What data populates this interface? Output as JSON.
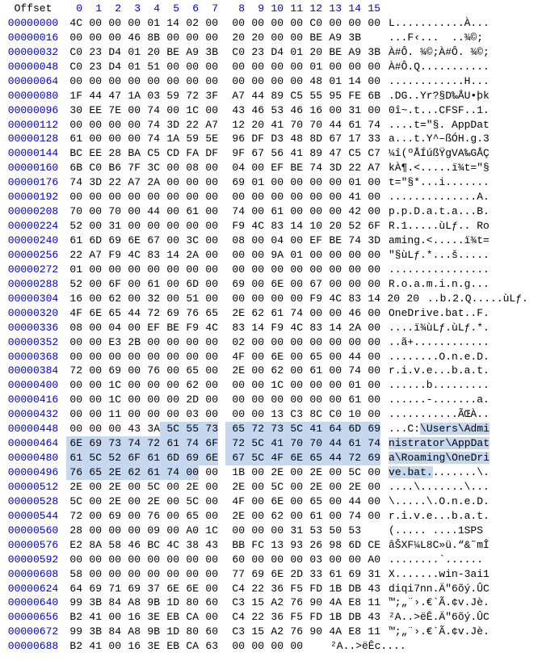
{
  "header": {
    "offset_label": "Offset",
    "cols": [
      "0",
      "1",
      "2",
      "3",
      "4",
      "5",
      "6",
      "7",
      "8",
      "9",
      "10",
      "11",
      "12",
      "13",
      "14",
      "15"
    ]
  },
  "highlight": {
    "start": 453,
    "end": 503
  },
  "rows": [
    {
      "offset": "00000000",
      "hex": [
        "4C",
        "00",
        "00",
        "00",
        "01",
        "14",
        "02",
        "00",
        "00",
        "00",
        "00",
        "00",
        "C0",
        "00",
        "00",
        "00"
      ],
      "ascii": "L...........À..."
    },
    {
      "offset": "00000016",
      "hex": [
        "00",
        "00",
        "00",
        "46",
        "8B",
        "00",
        "00",
        "00",
        "20",
        "20",
        "00",
        "00",
        "BE",
        "A9",
        "3B",
        ""
      ],
      "ascii": "...F‹...  ..¾©;"
    },
    {
      "offset": "00000032",
      "hex": [
        "C0",
        "23",
        "D4",
        "01",
        "20",
        "BE",
        "A9",
        "3B",
        "C0",
        "23",
        "D4",
        "01",
        "20",
        "BE",
        "A9",
        "3B"
      ],
      "ascii": "À#Ô. ¾©;À#Ô. ¾©;"
    },
    {
      "offset": "00000048",
      "hex": [
        "C0",
        "23",
        "D4",
        "01",
        "51",
        "00",
        "00",
        "00",
        "00",
        "00",
        "00",
        "00",
        "01",
        "00",
        "00",
        "00"
      ],
      "ascii": "À#Ô.Q..........."
    },
    {
      "offset": "00000064",
      "hex": [
        "00",
        "00",
        "00",
        "00",
        "00",
        "00",
        "00",
        "00",
        "00",
        "00",
        "00",
        "00",
        "48",
        "01",
        "14",
        "00"
      ],
      "ascii": "............H..."
    },
    {
      "offset": "00000080",
      "hex": [
        "1F",
        "44",
        "47",
        "1A",
        "03",
        "59",
        "72",
        "3F",
        "A7",
        "44",
        "89",
        "C5",
        "55",
        "95",
        "FE",
        "6B"
      ],
      "ascii": ".DG..Yr?§D‰ÅU•þk"
    },
    {
      "offset": "00000096",
      "hex": [
        "30",
        "EE",
        "7E",
        "00",
        "74",
        "00",
        "1C",
        "00",
        "43",
        "46",
        "53",
        "46",
        "16",
        "00",
        "31",
        "00"
      ],
      "ascii": "0î~.t...CFSF..1."
    },
    {
      "offset": "00000112",
      "hex": [
        "00",
        "00",
        "00",
        "00",
        "74",
        "3D",
        "22",
        "A7",
        "12",
        "20",
        "41",
        "70",
        "70",
        "44",
        "61",
        "74"
      ],
      "ascii": "....t=\"§. AppDat"
    },
    {
      "offset": "00000128",
      "hex": [
        "61",
        "00",
        "00",
        "00",
        "74",
        "1A",
        "59",
        "5E",
        "96",
        "DF",
        "D3",
        "48",
        "8D",
        "67",
        "17",
        "33"
      ],
      "ascii": "a...t.Y^–ßÓH.g.3"
    },
    {
      "offset": "00000144",
      "hex": [
        "BC",
        "EE",
        "28",
        "BA",
        "C5",
        "CD",
        "FA",
        "DF",
        "9F",
        "67",
        "56",
        "41",
        "89",
        "47",
        "C5",
        "C7"
      ],
      "ascii": "¼î(ºÅÍúßŸgVA‰GÅÇ"
    },
    {
      "offset": "00000160",
      "hex": [
        "6B",
        "C0",
        "B6",
        "7F",
        "3C",
        "00",
        "08",
        "00",
        "04",
        "00",
        "EF",
        "BE",
        "74",
        "3D",
        "22",
        "A7"
      ],
      "ascii": "kÀ¶.<.....ï¾t=\"§"
    },
    {
      "offset": "00000176",
      "hex": [
        "74",
        "3D",
        "22",
        "A7",
        "2A",
        "00",
        "00",
        "00",
        "69",
        "01",
        "00",
        "00",
        "00",
        "00",
        "01",
        "00"
      ],
      "ascii": "t=\"§*...i......."
    },
    {
      "offset": "00000192",
      "hex": [
        "00",
        "00",
        "00",
        "00",
        "00",
        "00",
        "00",
        "00",
        "00",
        "00",
        "00",
        "00",
        "00",
        "00",
        "41",
        "00"
      ],
      "ascii": "..............A."
    },
    {
      "offset": "00000208",
      "hex": [
        "70",
        "00",
        "70",
        "00",
        "44",
        "00",
        "61",
        "00",
        "74",
        "00",
        "61",
        "00",
        "00",
        "00",
        "42",
        "00"
      ],
      "ascii": "p.p.D.a.t.a...B."
    },
    {
      "offset": "00000224",
      "hex": [
        "52",
        "00",
        "31",
        "00",
        "00",
        "00",
        "00",
        "00",
        "F9",
        "4C",
        "83",
        "14",
        "10",
        "20",
        "52",
        "6F"
      ],
      "ascii": "R.1.....ùLƒ.. Ro"
    },
    {
      "offset": "00000240",
      "hex": [
        "61",
        "6D",
        "69",
        "6E",
        "67",
        "00",
        "3C",
        "00",
        "08",
        "00",
        "04",
        "00",
        "EF",
        "BE",
        "74",
        "3D"
      ],
      "ascii": "aming.<.....ï¾t="
    },
    {
      "offset": "00000256",
      "hex": [
        "22",
        "A7",
        "F9",
        "4C",
        "83",
        "14",
        "2A",
        "00",
        "00",
        "00",
        "9A",
        "01",
        "00",
        "00",
        "00",
        "00"
      ],
      "ascii": "\"§ùLƒ.*...š....."
    },
    {
      "offset": "00000272",
      "hex": [
        "01",
        "00",
        "00",
        "00",
        "00",
        "00",
        "00",
        "00",
        "00",
        "00",
        "00",
        "00",
        "00",
        "00",
        "00",
        "00"
      ],
      "ascii": "................"
    },
    {
      "offset": "00000288",
      "hex": [
        "52",
        "00",
        "6F",
        "00",
        "61",
        "00",
        "6D",
        "00",
        "69",
        "00",
        "6E",
        "00",
        "67",
        "00",
        "00",
        "00"
      ],
      "ascii": "R.o.a.m.i.n.g..."
    },
    {
      "offset": "00000304",
      "hex": [
        "16",
        "00",
        "62",
        "00",
        "32",
        "00",
        "51",
        "00",
        "00",
        "00",
        "00",
        "00",
        "F9",
        "4C",
        "83",
        "14",
        "20",
        "20"
      ],
      "ascii": "..b.2.Q.....ùLƒ.  "
    },
    {
      "offset": "00000320",
      "hex": [
        "4F",
        "6E",
        "65",
        "44",
        "72",
        "69",
        "76",
        "65",
        "2E",
        "62",
        "61",
        "74",
        "00",
        "00",
        "46",
        "00"
      ],
      "ascii": "OneDrive.bat..F."
    },
    {
      "offset": "00000336",
      "hex": [
        "08",
        "00",
        "04",
        "00",
        "EF",
        "BE",
        "F9",
        "4C",
        "83",
        "14",
        "F9",
        "4C",
        "83",
        "14",
        "2A",
        "00"
      ],
      "ascii": "....ï¾ùLƒ.ùLƒ.*."
    },
    {
      "offset": "00000352",
      "hex": [
        "00",
        "00",
        "E3",
        "2B",
        "00",
        "00",
        "00",
        "00",
        "02",
        "00",
        "00",
        "00",
        "00",
        "00",
        "00",
        "00"
      ],
      "ascii": "..ã+............"
    },
    {
      "offset": "00000368",
      "hex": [
        "00",
        "00",
        "00",
        "00",
        "00",
        "00",
        "00",
        "00",
        "4F",
        "00",
        "6E",
        "00",
        "65",
        "00",
        "44",
        "00"
      ],
      "ascii": "........O.n.e.D."
    },
    {
      "offset": "00000384",
      "hex": [
        "72",
        "00",
        "69",
        "00",
        "76",
        "00",
        "65",
        "00",
        "2E",
        "00",
        "62",
        "00",
        "61",
        "00",
        "74",
        "00"
      ],
      "ascii": "r.i.v.e...b.a.t."
    },
    {
      "offset": "00000400",
      "hex": [
        "00",
        "00",
        "1C",
        "00",
        "00",
        "00",
        "62",
        "00",
        "00",
        "00",
        "1C",
        "00",
        "00",
        "00",
        "01",
        "00"
      ],
      "ascii": "......b........."
    },
    {
      "offset": "00000416",
      "hex": [
        "00",
        "00",
        "1C",
        "00",
        "00",
        "00",
        "2D",
        "00",
        "00",
        "00",
        "00",
        "00",
        "00",
        "00",
        "61",
        "00"
      ],
      "ascii": "......-.......a."
    },
    {
      "offset": "00000432",
      "hex": [
        "00",
        "00",
        "11",
        "00",
        "00",
        "00",
        "03",
        "00",
        "00",
        "00",
        "13",
        "C3",
        "8C",
        "C0",
        "10",
        "00"
      ],
      "ascii": "...........ÃŒÀ.."
    },
    {
      "offset": "00000448",
      "hex": [
        "00",
        "00",
        "00",
        "43",
        "3A",
        "5C",
        "55",
        "73",
        "65",
        "72",
        "73",
        "5C",
        "41",
        "64",
        "6D",
        "69"
      ],
      "ascii": "...C:\\Users\\Admi"
    },
    {
      "offset": "00000464",
      "hex": [
        "6E",
        "69",
        "73",
        "74",
        "72",
        "61",
        "74",
        "6F",
        "72",
        "5C",
        "41",
        "70",
        "70",
        "44",
        "61",
        "74"
      ],
      "ascii": "nistrator\\AppDat"
    },
    {
      "offset": "00000480",
      "hex": [
        "61",
        "5C",
        "52",
        "6F",
        "61",
        "6D",
        "69",
        "6E",
        "67",
        "5C",
        "4F",
        "6E",
        "65",
        "44",
        "72",
        "69"
      ],
      "ascii": "a\\Roaming\\OneDri"
    },
    {
      "offset": "00000496",
      "hex": [
        "76",
        "65",
        "2E",
        "62",
        "61",
        "74",
        "00",
        "00",
        "1B",
        "00",
        "2E",
        "00",
        "2E",
        "00",
        "5C",
        "00"
      ],
      "ascii": "ve.bat........\\."
    },
    {
      "offset": "00000512",
      "hex": [
        "2E",
        "00",
        "2E",
        "00",
        "5C",
        "00",
        "2E",
        "00",
        "2E",
        "00",
        "5C",
        "00",
        "2E",
        "00",
        "2E",
        "00"
      ],
      "ascii": "....\\.......\\..."
    },
    {
      "offset": "00000528",
      "hex": [
        "5C",
        "00",
        "2E",
        "00",
        "2E",
        "00",
        "5C",
        "00",
        "4F",
        "00",
        "6E",
        "00",
        "65",
        "00",
        "44",
        "00"
      ],
      "ascii": "\\.....\\.O.n.e.D."
    },
    {
      "offset": "00000544",
      "hex": [
        "72",
        "00",
        "69",
        "00",
        "76",
        "00",
        "65",
        "00",
        "2E",
        "00",
        "62",
        "00",
        "61",
        "00",
        "74",
        "00"
      ],
      "ascii": "r.i.v.e...b.a.t."
    },
    {
      "offset": "00000560",
      "hex": [
        "28",
        "00",
        "00",
        "00",
        "09",
        "00",
        "A0",
        "1C",
        "00",
        "00",
        "00",
        "31",
        "53",
        "50",
        "53",
        ""
      ],
      "ascii": "(..... ....1SPS"
    },
    {
      "offset": "00000576",
      "hex": [
        "E2",
        "8A",
        "58",
        "46",
        "BC",
        "4C",
        "38",
        "43",
        "BB",
        "FC",
        "13",
        "93",
        "26",
        "98",
        "6D",
        "CE"
      ],
      "ascii": "âŠXF¼L8C»ü.“&˜mÎ"
    },
    {
      "offset": "00000592",
      "hex": [
        "00",
        "00",
        "00",
        "00",
        "00",
        "00",
        "00",
        "00",
        "60",
        "00",
        "00",
        "00",
        "03",
        "00",
        "00",
        "A0"
      ],
      "ascii": "........`...... "
    },
    {
      "offset": "00000608",
      "hex": [
        "58",
        "00",
        "00",
        "00",
        "00",
        "00",
        "00",
        "00",
        "77",
        "69",
        "6E",
        "2D",
        "33",
        "61",
        "69",
        "31"
      ],
      "ascii": "X.......win-3ai1"
    },
    {
      "offset": "00000624",
      "hex": [
        "64",
        "69",
        "71",
        "69",
        "37",
        "6E",
        "6E",
        "00",
        "C4",
        "22",
        "36",
        "F5",
        "FD",
        "1B",
        "DB",
        "43"
      ],
      "ascii": "diqi7nn.Ä\"6õý.ÛC"
    },
    {
      "offset": "00000640",
      "hex": [
        "99",
        "3B",
        "84",
        "A8",
        "9B",
        "1D",
        "80",
        "60",
        "C3",
        "15",
        "A2",
        "76",
        "90",
        "4A",
        "E8",
        "11"
      ],
      "ascii": "™;„¨›.€`Ã.¢v.Jè."
    },
    {
      "offset": "00000656",
      "hex": [
        "B2",
        "41",
        "00",
        "16",
        "3E",
        "EB",
        "CA",
        "00",
        "C4",
        "22",
        "36",
        "F5",
        "FD",
        "1B",
        "DB",
        "43"
      ],
      "ascii": "²A..>ëÊ.Ä\"6õý.ÛC"
    },
    {
      "offset": "00000672",
      "hex": [
        "99",
        "3B",
        "84",
        "A8",
        "9B",
        "1D",
        "80",
        "60",
        "C3",
        "15",
        "A2",
        "76",
        "90",
        "4A",
        "E8",
        "11"
      ],
      "ascii": "™;„¨›.€`Ã.¢v.Jè."
    },
    {
      "offset": "00000688",
      "hex": [
        "B2",
        "41",
        "00",
        "16",
        "3E",
        "EB",
        "CA",
        "63",
        "00",
        "00",
        "00",
        "00",
        ""
      ],
      "ascii": "²A..>ëÊc...."
    }
  ],
  "chart_data": null
}
